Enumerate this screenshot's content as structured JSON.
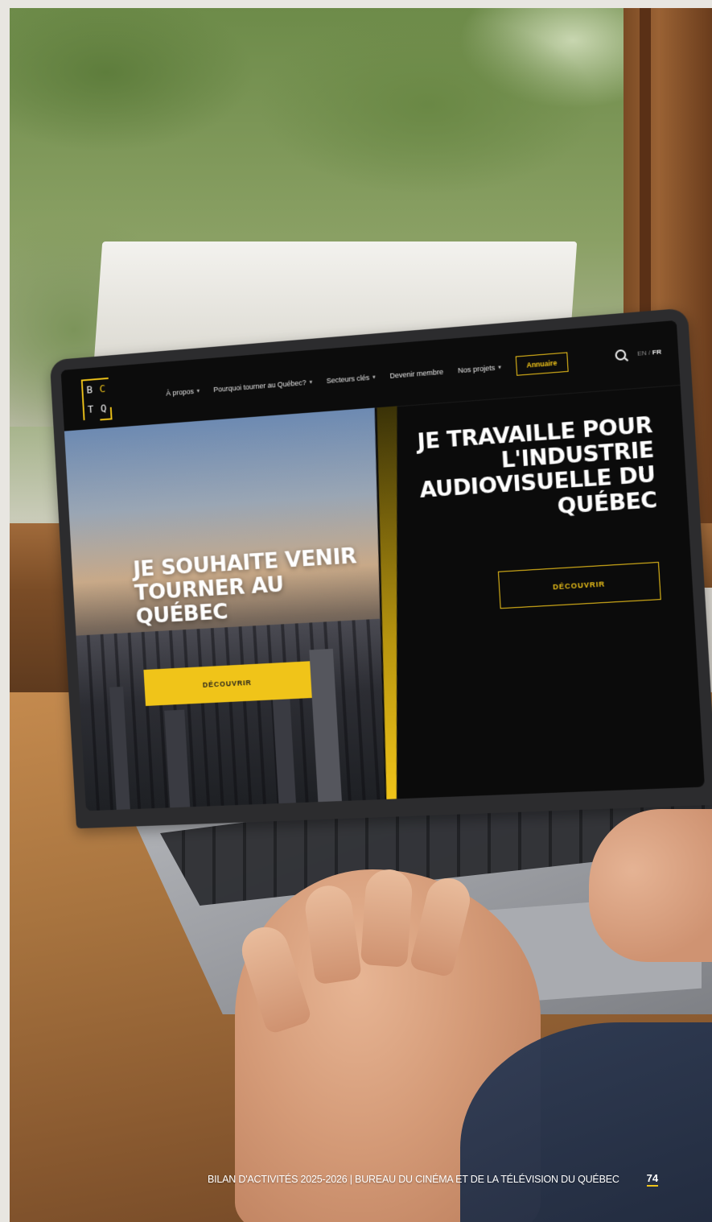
{
  "site": {
    "logo_letters": [
      "B",
      "C",
      "T",
      "Q"
    ],
    "nav": [
      {
        "label": "À propos",
        "has_dropdown": true
      },
      {
        "label": "Pourquoi tourner au Québec?",
        "has_dropdown": true
      },
      {
        "label": "Secteurs clés",
        "has_dropdown": true
      },
      {
        "label": "Devenir membre",
        "has_dropdown": false
      },
      {
        "label": "Nos projets",
        "has_dropdown": true
      }
    ],
    "annuaire_label": "Annuaire",
    "lang_en": "EN",
    "lang_separator": "/",
    "lang_fr": "FR",
    "hero_left": {
      "title": "JE SOUHAITE VENIR TOURNER AU QUÉBEC",
      "button": "DÉCOUVRIR"
    },
    "hero_right": {
      "title": "JE TRAVAILLE POUR L'INDUSTRIE AUDIOVISUELLE DU QUÉBEC",
      "button": "DÉCOUVRIR"
    }
  },
  "footer": {
    "text": "BILAN D'ACTIVITÉS 2025-2026  |  BUREAU DU CINÉMA ET DE LA TÉLÉVISION DU QUÉBEC",
    "page_number": "74"
  },
  "colors": {
    "accent": "#f0c419",
    "screen_bg": "#0b0b0b"
  }
}
